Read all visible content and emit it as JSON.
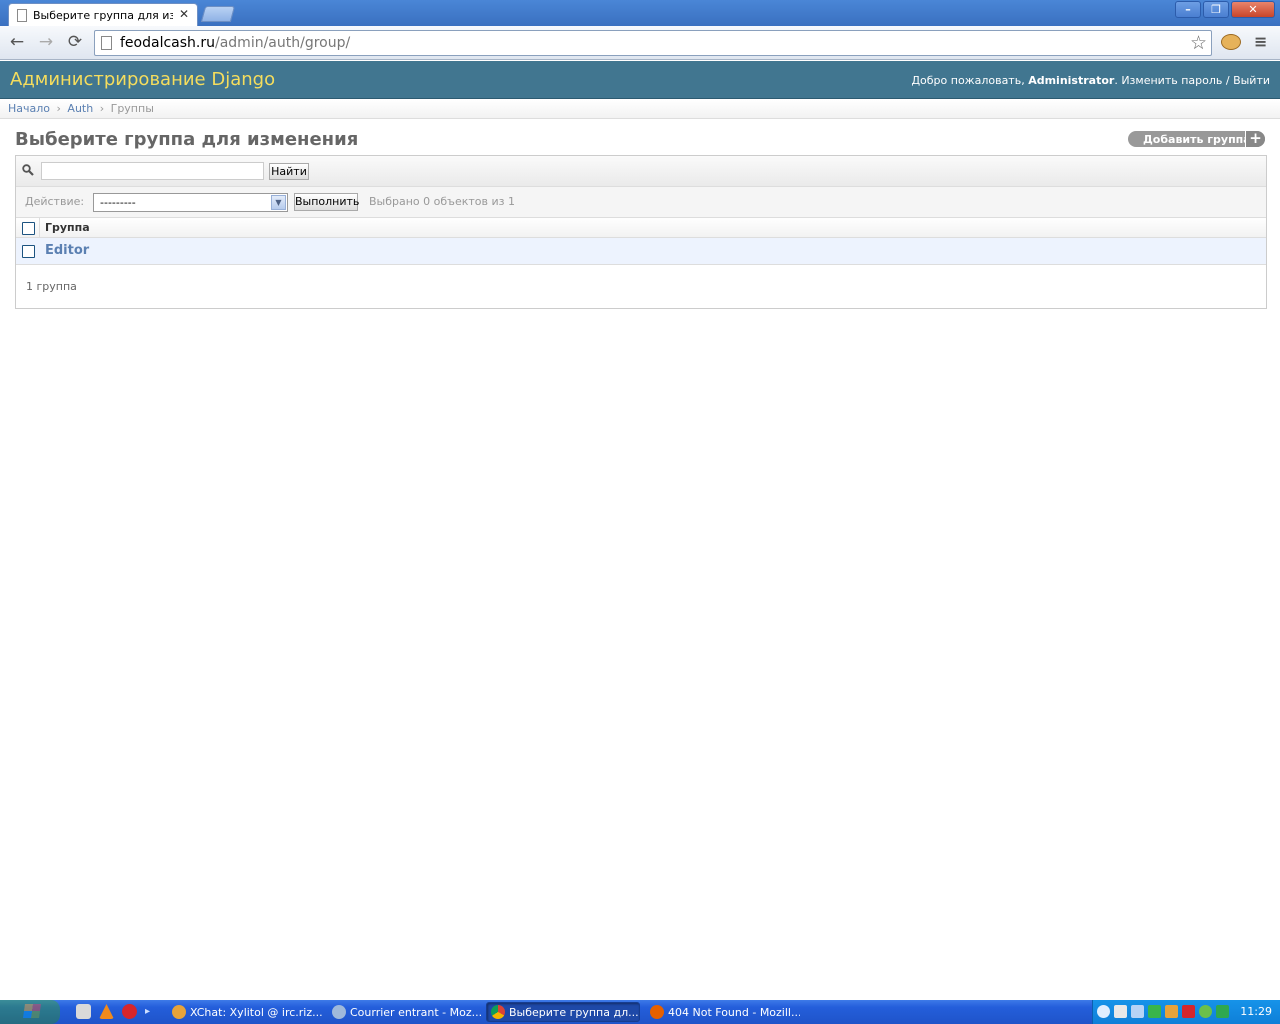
{
  "browser": {
    "tab_title": "Выберите группа для изме",
    "tab_close": "✕",
    "url_host": "feodalcash.ru",
    "url_path": "/admin/auth/group/",
    "nav_back": "←",
    "nav_forward": "→",
    "nav_reload": "⟳",
    "star": "☆",
    "wrench": "≡",
    "win_minimize": "–",
    "win_maximize": "❐",
    "win_close": "✕"
  },
  "header": {
    "branding": "Администрирование Django",
    "welcome": "Добро пожаловать, ",
    "username": "Administrator",
    "after_user": ". ",
    "change_password": "Изменить пароль",
    "separator": " / ",
    "logout": "Выйти"
  },
  "breadcrumbs": {
    "home": "Начало",
    "app": "Auth",
    "current": "Группы",
    "sep": "›"
  },
  "content": {
    "title": "Выберите группа для изменения",
    "add_button": "Добавить группа",
    "add_icon": "+"
  },
  "search": {
    "value": "",
    "button": "Найти"
  },
  "actions": {
    "label": "Действие:",
    "selected_option": "---------",
    "go_button": "Выполнить",
    "counter": "Выбрано 0 объектов из 1"
  },
  "table": {
    "header": "Группа",
    "rows": [
      {
        "name": "Editor",
        "checked": false
      }
    ]
  },
  "paginator": "1 группа",
  "taskbar": {
    "tasks": [
      {
        "label": "XChat: Xylitol @ irc.riz..."
      },
      {
        "label": "Courrier entrant - Moz..."
      },
      {
        "label": "Выберите группа дл..."
      },
      {
        "label": "404 Not Found - Mozill..."
      }
    ],
    "clock": "11:29"
  },
  "colors": {
    "header_bg": "#417690",
    "branding": "#f5dd5d",
    "link": "#5b80b2",
    "row_highlight": "#edf3fe"
  }
}
